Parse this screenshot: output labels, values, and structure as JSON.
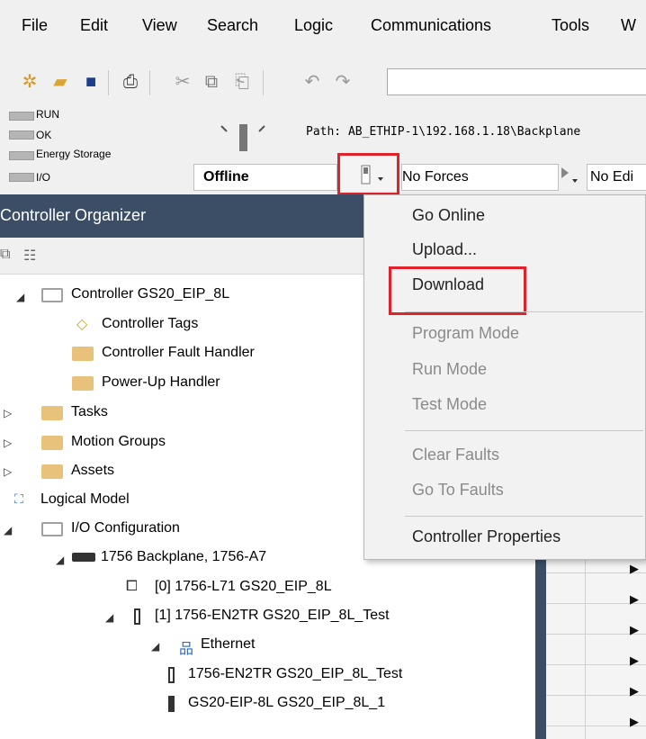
{
  "menubar": {
    "items": [
      "File",
      "Edit",
      "View",
      "Search",
      "Logic",
      "Communications",
      "Tools",
      "W"
    ]
  },
  "toolbar": {
    "icons": [
      "new-file-icon",
      "open-folder-icon",
      "save-icon",
      "print-icon",
      "cut-icon",
      "copy-icon",
      "paste-icon",
      "undo-icon",
      "redo-icon"
    ]
  },
  "status": {
    "leds": [
      "RUN",
      "OK",
      "Energy Storage",
      "I/O"
    ],
    "path": "Path: AB_ETHIP-1\\192.168.1.18\\Backplane",
    "mode": "Offline",
    "forces": "No Forces",
    "edits": "No Edi"
  },
  "organizer": {
    "title": "Controller Organizer",
    "tree": [
      {
        "label": "Controller GS20_EIP_8L"
      },
      {
        "label": "Controller Tags"
      },
      {
        "label": "Controller Fault Handler"
      },
      {
        "label": "Power-Up Handler"
      },
      {
        "label": "Tasks"
      },
      {
        "label": "Motion Groups"
      },
      {
        "label": "Assets"
      },
      {
        "label": "Logical Model"
      },
      {
        "label": "I/O Configuration"
      },
      {
        "label": "1756 Backplane, 1756-A7"
      },
      {
        "label": "[0] 1756-L71 GS20_EIP_8L"
      },
      {
        "label": "[1] 1756-EN2TR GS20_EIP_8L_Test"
      },
      {
        "label": "Ethernet"
      },
      {
        "label": "1756-EN2TR GS20_EIP_8L_Test"
      },
      {
        "label": "GS20-EIP-8L GS20_EIP_8L_1"
      }
    ]
  },
  "dropdown": {
    "items": [
      {
        "label": "Go Online",
        "enabled": true
      },
      {
        "label": "Upload...",
        "enabled": true
      },
      {
        "label": "Download",
        "enabled": true
      },
      {
        "label": "Program Mode",
        "enabled": false
      },
      {
        "label": "Run Mode",
        "enabled": false
      },
      {
        "label": "Test Mode",
        "enabled": false
      },
      {
        "label": "Clear Faults",
        "enabled": false
      },
      {
        "label": "Go To Faults",
        "enabled": false
      },
      {
        "label": "Controller Properties",
        "enabled": true
      }
    ]
  },
  "colors": {
    "organizer_header": "#3b4e66",
    "highlight": "#e0222a",
    "folder": "#e8c27a"
  }
}
